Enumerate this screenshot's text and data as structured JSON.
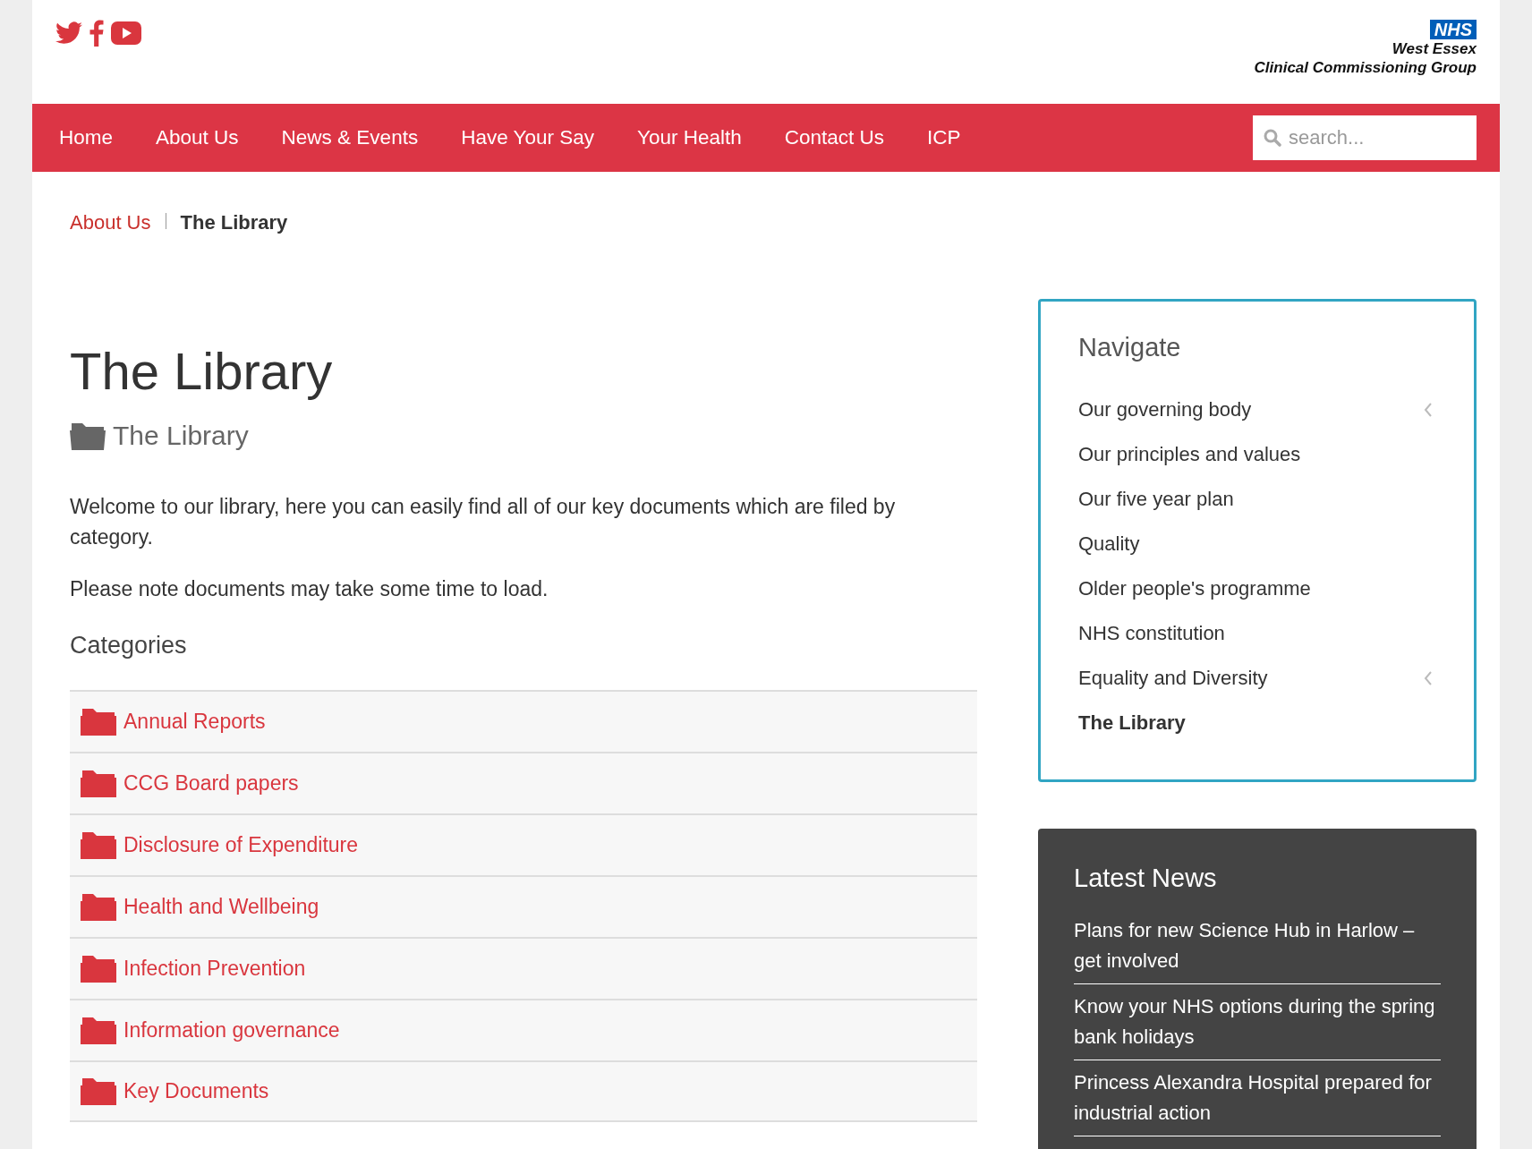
{
  "logo": {
    "badge": "NHS",
    "line1": "West Essex",
    "line2": "Clinical Commissioning Group"
  },
  "nav": [
    {
      "label": "Home"
    },
    {
      "label": "About Us"
    },
    {
      "label": "News & Events"
    },
    {
      "label": "Have Your Say"
    },
    {
      "label": "Your Health"
    },
    {
      "label": "Contact Us"
    },
    {
      "label": "ICP"
    }
  ],
  "search": {
    "placeholder": "search..."
  },
  "breadcrumb": [
    {
      "label": "About Us",
      "current": false
    },
    {
      "label": "The Library",
      "current": true
    }
  ],
  "title": "The Library",
  "subtitle": "The Library",
  "paragraphs": [
    "Welcome to our library, here you can easily find all of our key documents which are filed by category.",
    "Please note documents may take some time to load."
  ],
  "categories_heading": "Categories",
  "categories": [
    {
      "label": "Annual Reports"
    },
    {
      "label": "CCG Board papers"
    },
    {
      "label": "Disclosure of Expenditure"
    },
    {
      "label": "Health and Wellbeing"
    },
    {
      "label": "Infection Prevention"
    },
    {
      "label": "Information governance"
    },
    {
      "label": "Key Documents"
    }
  ],
  "navigate": {
    "title": "Navigate",
    "items": [
      {
        "label": "Our governing body",
        "expandable": true,
        "selected": false
      },
      {
        "label": "Our principles and values",
        "expandable": false,
        "selected": false
      },
      {
        "label": "Our five year plan",
        "expandable": false,
        "selected": false
      },
      {
        "label": "Quality",
        "expandable": false,
        "selected": false
      },
      {
        "label": "Older people's programme",
        "expandable": false,
        "selected": false
      },
      {
        "label": "NHS constitution",
        "expandable": false,
        "selected": false
      },
      {
        "label": "Equality and Diversity",
        "expandable": true,
        "selected": false
      },
      {
        "label": "The Library",
        "expandable": false,
        "selected": true
      }
    ]
  },
  "latest_news": {
    "title": "Latest News",
    "items": [
      "Plans for new Science Hub in Harlow – get involved",
      "Know your NHS options during the spring bank holidays",
      "Princess Alexandra Hospital prepared for industrial action"
    ]
  }
}
